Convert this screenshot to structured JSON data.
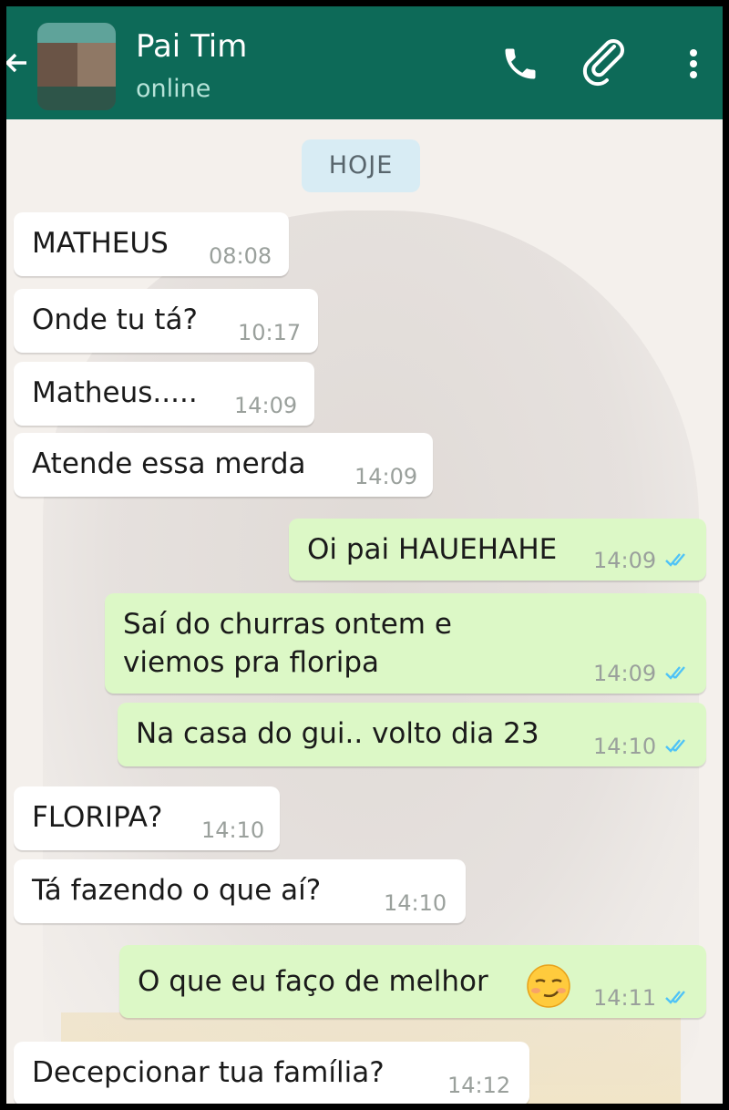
{
  "header": {
    "contact_name": "Pai Tim",
    "status": "online",
    "back_icon": "arrow-left",
    "call_icon": "phone-icon",
    "attach_icon": "paperclip-icon",
    "menu_icon": "more-vertical-icon",
    "background_color": "#0d6a58"
  },
  "chat": {
    "date_label": "HOJE",
    "messages": [
      {
        "direction": "in",
        "text": "MATHEUS",
        "time": "08:08"
      },
      {
        "direction": "in",
        "text": "Onde tu tá?",
        "time": "10:17"
      },
      {
        "direction": "in",
        "text": "Matheus.....",
        "time": "14:09"
      },
      {
        "direction": "in",
        "text": "Atende essa merda",
        "time": "14:09"
      },
      {
        "direction": "out",
        "text": "Oi pai HAUEHAHE",
        "time": "14:09",
        "read": true
      },
      {
        "direction": "out",
        "text_line1": "Saí do churras ontem e",
        "text_line2": "viemos pra floripa",
        "time": "14:09",
        "read": true
      },
      {
        "direction": "out",
        "text": "Na casa do gui.. volto dia 23",
        "time": "14:10",
        "read": true
      },
      {
        "direction": "in",
        "text": "FLORIPA?",
        "time": "14:10"
      },
      {
        "direction": "in",
        "text": "Tá fazendo o que aí?",
        "time": "14:10"
      },
      {
        "direction": "out",
        "text": "O que eu faço de melhor",
        "emoji": "smirk-emoji",
        "time": "14:11",
        "read": true
      },
      {
        "direction": "in",
        "text": "Decepcionar tua família?",
        "time": "14:12"
      }
    ],
    "incoming_color": "#ffffff",
    "outgoing_color": "#dcf8c6",
    "read_tick_color": "#4fc3f7"
  }
}
